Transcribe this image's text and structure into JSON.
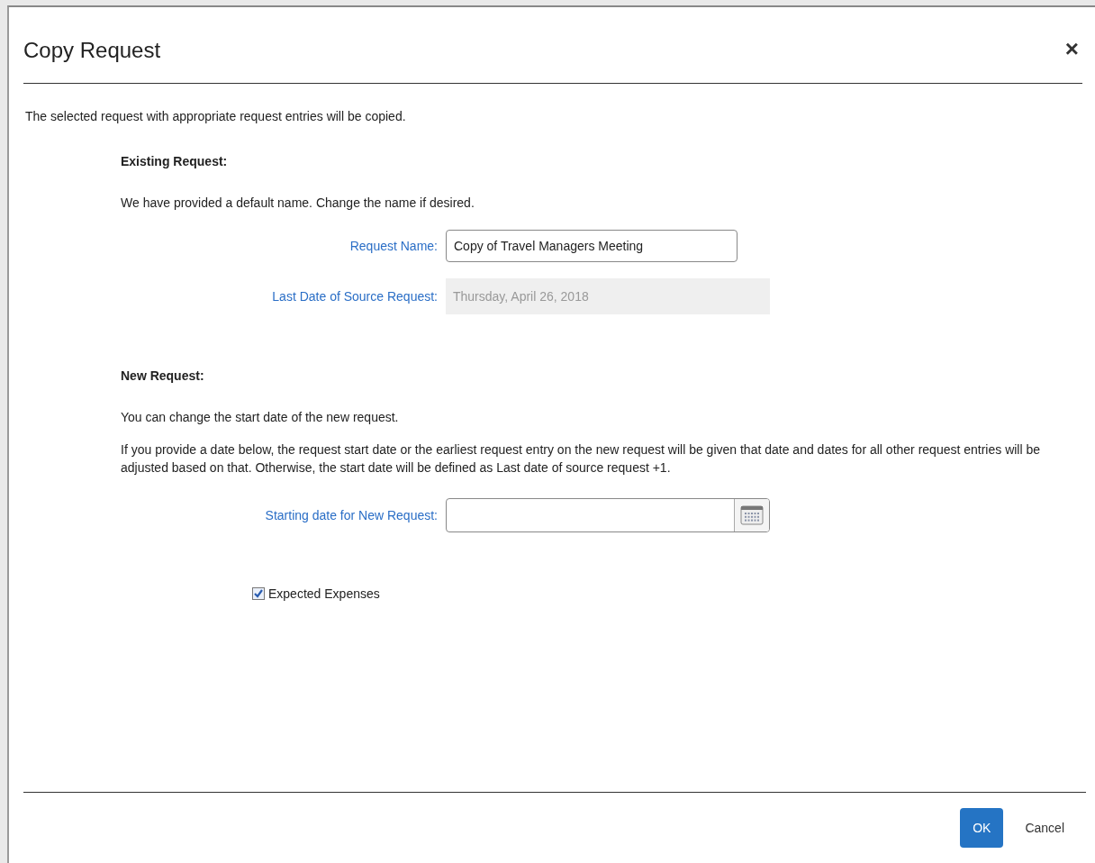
{
  "dialog": {
    "title": "Copy Request",
    "close": "×"
  },
  "intro": "The selected request with appropriate request entries will be copied.",
  "existing": {
    "heading": "Existing Request:",
    "note": "We have provided a default name. Change the name if desired.",
    "fields": [
      {
        "label": "Request Name:",
        "value": "Copy of Travel Managers Meeting",
        "disabled": false
      },
      {
        "label": "Last Date of Source Request:",
        "value": "Thursday, April 26, 2018",
        "disabled": true
      }
    ]
  },
  "new": {
    "heading": "New Request:",
    "note": "You can change the start date of the new request.",
    "explanation": "If you provide a date below, the request start date or the earliest request entry on the new request will be given that date and dates for all other request entries will be adjusted based on that. Otherwise, the start date will be defined as Last date of source request +1.",
    "date_field": {
      "label": "Starting date for New Request:"
    },
    "options": [
      {
        "label": "Expected Expenses",
        "checked": true
      }
    ]
  },
  "buttons": [
    {
      "label": "OK",
      "kind": "primary"
    },
    {
      "label": "Cancel",
      "kind": "secondary"
    }
  ]
}
